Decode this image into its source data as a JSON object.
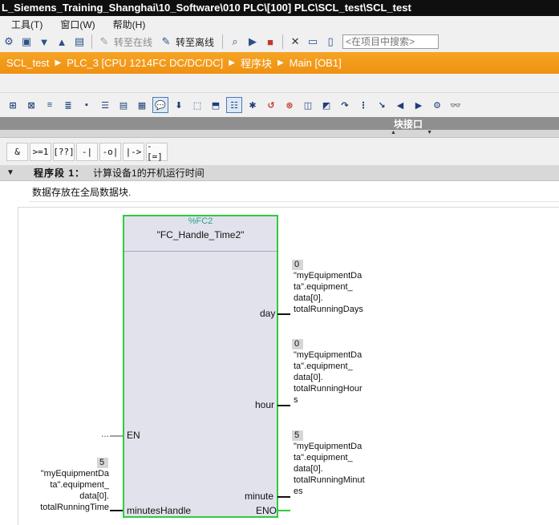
{
  "window": {
    "title": "L_Siemens_Training_Shanghai\\10_Software\\010 PLC\\[100] PLC\\SCL_test\\SCL_test"
  },
  "menu": {
    "items": [
      {
        "label": "工具(T)"
      },
      {
        "label": "窗口(W)"
      },
      {
        "label": "帮助(H)"
      }
    ]
  },
  "toolbar": {
    "go_online_label": "转至在线",
    "go_offline_label": "转至离线",
    "search_placeholder": "<在项目中搜索>"
  },
  "breadcrumb": {
    "items": [
      {
        "label": "SCL_test"
      },
      {
        "label": "PLC_3 [CPU 1214FC DC/DC/DC]"
      },
      {
        "label": "程序块"
      },
      {
        "label": "Main [OB1]"
      }
    ],
    "separator": "▶"
  },
  "interface_panel": {
    "label": "块接口"
  },
  "lad_toolbar": {
    "buttons": [
      {
        "label": "&"
      },
      {
        "label": ">=1"
      },
      {
        "label": "[??]"
      },
      {
        "label": "-|"
      },
      {
        "label": "-o|"
      },
      {
        "label": "|->"
      },
      {
        "label": "-[=]"
      }
    ]
  },
  "network": {
    "caret": "▼",
    "title": "程序段 1：",
    "title_text": "计算设备1的开机运行时间",
    "comment": "数据存放在全局数据块."
  },
  "function_block": {
    "address": "%FC2",
    "name": "\"FC_Handle_Time2\"",
    "inputs": {
      "en": {
        "label": "EN",
        "operand": "..."
      },
      "minutes_handle": {
        "label": "minutesHandle",
        "value": "5",
        "operand": "\"myEquipmentDa\nta\".equipment_\ndata[0].\ntotalRunningTime"
      }
    },
    "outputs": {
      "day": {
        "label": "day",
        "value": "0",
        "operand": "\"myEquipmentDa\nta\".equipment_\ndata[0].\ntotalRunningDays"
      },
      "hour": {
        "label": "hour",
        "value": "0",
        "operand": "\"myEquipmentDa\nta\".equipment_\ndata[0].\ntotalRunningHour\ns"
      },
      "minute": {
        "label": "minute",
        "value": "5",
        "operand": "\"myEquipmentDa\nta\".equipment_\ndata[0].\ntotalRunningMinut\nes"
      },
      "eno": {
        "label": "ENO"
      }
    }
  },
  "colors": {
    "breadcrumb_bg": "#f39c12",
    "box_border_active": "#2ecc40",
    "fc_address": "#2a9d8f"
  }
}
